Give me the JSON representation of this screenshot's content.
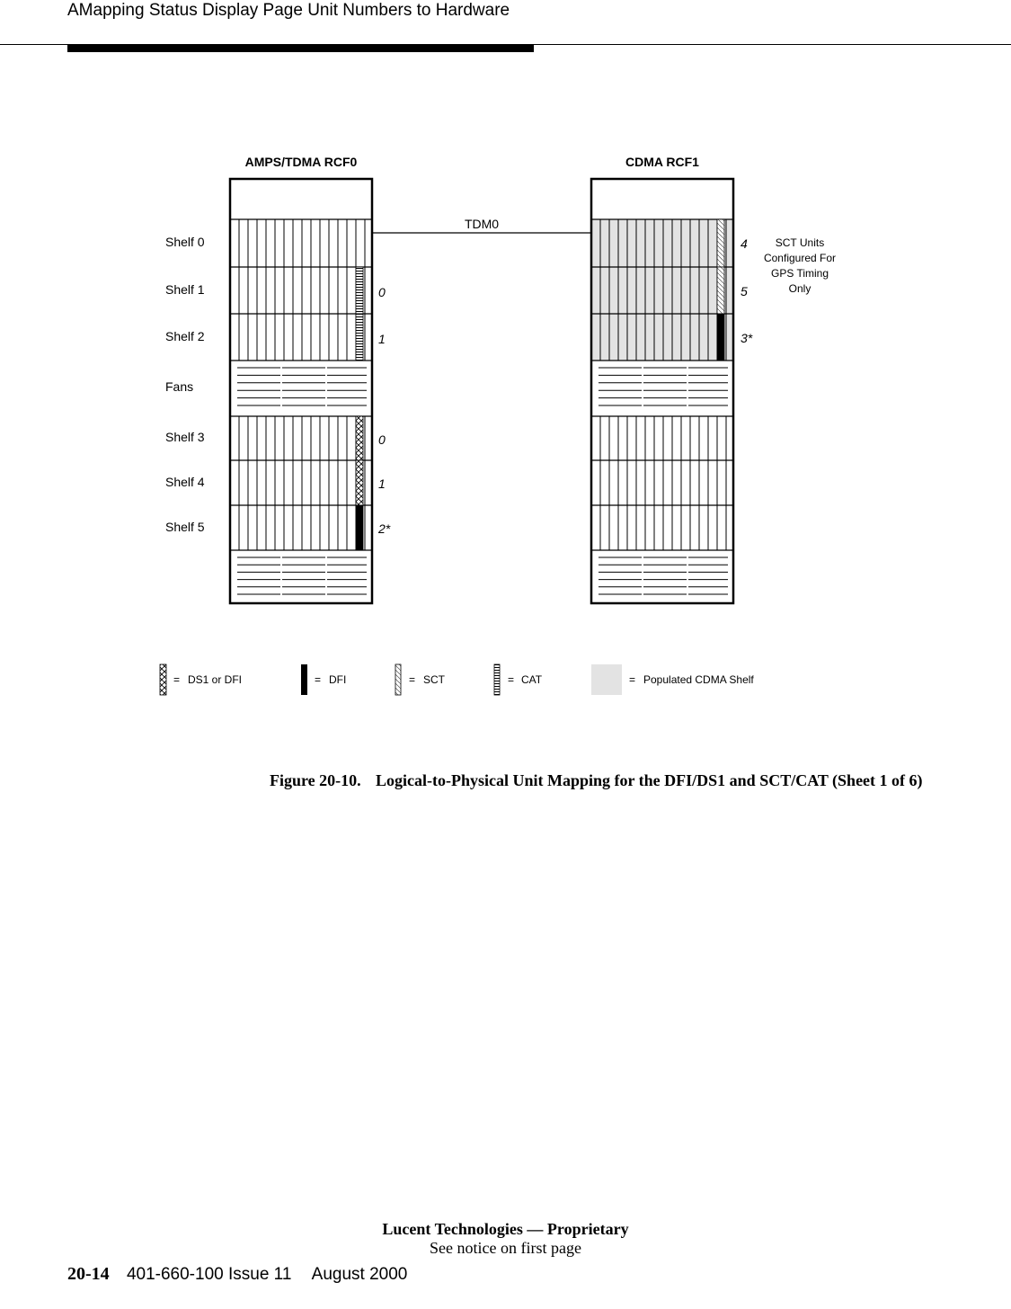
{
  "header": {
    "title": "AMapping Status Display Page Unit Numbers to Hardware"
  },
  "diagram": {
    "frames": [
      {
        "title": "AMPS/TDMA RCF0",
        "populated_cdma": false
      },
      {
        "title": "CDMA RCF1",
        "populated_cdma": true
      }
    ],
    "shelf_labels": [
      "Shelf 0",
      "Shelf 1",
      "Shelf 2",
      "Fans",
      "Shelf 3",
      "Shelf 4",
      "Shelf 5"
    ],
    "link_label": "TDM0",
    "rcf0_units": [
      {
        "shelf": "Shelf 1",
        "unit": "0",
        "type": "CAT"
      },
      {
        "shelf": "Shelf 2",
        "unit": "1",
        "type": "CAT"
      },
      {
        "shelf": "Shelf 3",
        "unit": "0",
        "type": "DS1 or DFI"
      },
      {
        "shelf": "Shelf 4",
        "unit": "1",
        "type": "DS1 or DFI"
      },
      {
        "shelf": "Shelf 5",
        "unit": "2*",
        "type": "DFI"
      }
    ],
    "rcf1_units": [
      {
        "shelf": "Shelf 0",
        "unit": "4",
        "type": "SCT"
      },
      {
        "shelf": "Shelf 1",
        "unit": "5",
        "type": "SCT"
      },
      {
        "shelf": "Shelf 2",
        "unit": "3*",
        "type": "DFI"
      }
    ],
    "note": [
      "SCT Units",
      "Configured For",
      "GPS Timing",
      "Only"
    ],
    "legend": [
      {
        "symbol": "ds1-or-dfi",
        "label": "DS1 or DFI"
      },
      {
        "symbol": "dfi",
        "label": "DFI"
      },
      {
        "symbol": "sct",
        "label": "SCT"
      },
      {
        "symbol": "cat",
        "label": "CAT"
      },
      {
        "symbol": "populated-cdma-shelf",
        "label": "Populated CDMA Shelf"
      }
    ],
    "legend_equals": "=",
    "colors": {
      "populated": "#e3e3e3",
      "line": "#000000"
    }
  },
  "caption": {
    "label": "Figure 20-10.",
    "text": "Logical-to-Physical Unit Mapping for the DFI/DS1 and SCT/CAT (Sheet 1 of 6)"
  },
  "footer": {
    "company": "Lucent Technologies — Proprietary",
    "notice": "See notice on first page",
    "page_number": "20-14",
    "doc_number": "401-660-100 Issue 11",
    "date": "August 2000"
  }
}
